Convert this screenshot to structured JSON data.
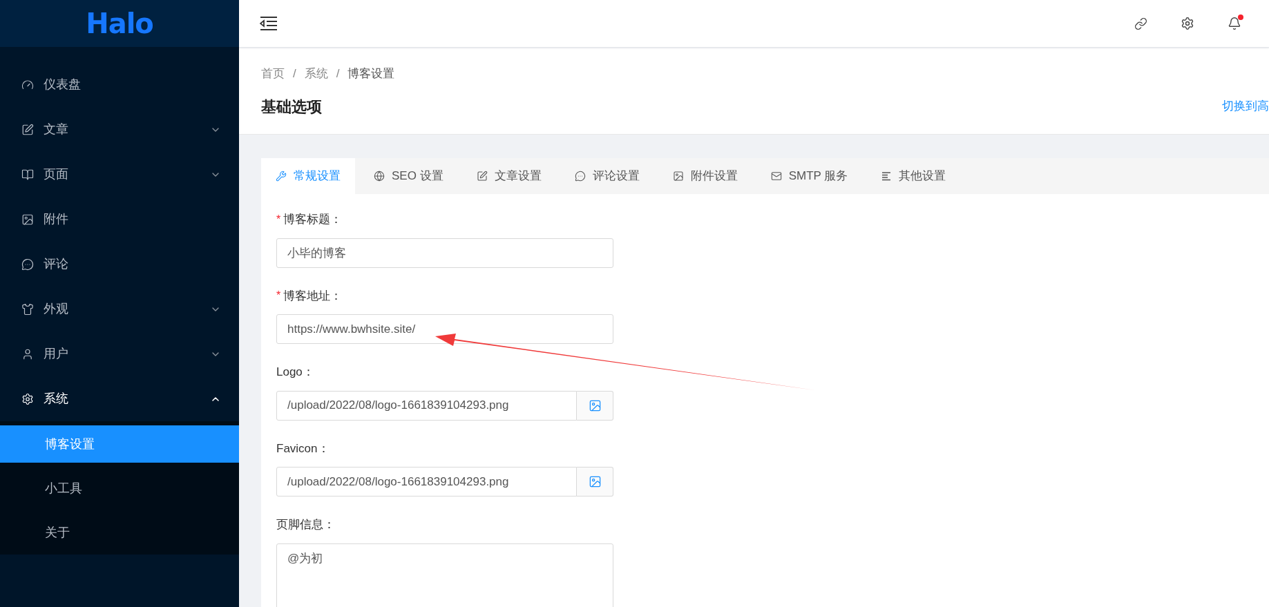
{
  "sidebar": {
    "logo": "Halo",
    "items": [
      {
        "label": "仪表盘",
        "expandable": false,
        "selected": false
      },
      {
        "label": "文章",
        "expandable": true,
        "expanded": false,
        "selected": false
      },
      {
        "label": "页面",
        "expandable": true,
        "expanded": false,
        "selected": false
      },
      {
        "label": "附件",
        "expandable": false,
        "selected": false
      },
      {
        "label": "评论",
        "expandable": false,
        "selected": false
      },
      {
        "label": "外观",
        "expandable": true,
        "expanded": false,
        "selected": false
      },
      {
        "label": "用户",
        "expandable": true,
        "expanded": false,
        "selected": false
      },
      {
        "label": "系统",
        "expandable": true,
        "expanded": true,
        "selected": true,
        "children": [
          {
            "label": "博客设置",
            "selected": true
          },
          {
            "label": "小工具",
            "selected": false
          },
          {
            "label": "关于",
            "selected": false
          }
        ]
      }
    ]
  },
  "header": {
    "notifications": {
      "unread": true
    }
  },
  "breadcrumb": {
    "separator": "/",
    "items": [
      "首页",
      "系统",
      "博客设置"
    ]
  },
  "page_title": "基础选项",
  "switch_link": "切换到高",
  "tabs": [
    {
      "label": "常规设置",
      "selected": true
    },
    {
      "label": "SEO 设置",
      "selected": false
    },
    {
      "label": "文章设置",
      "selected": false
    },
    {
      "label": "评论设置",
      "selected": false
    },
    {
      "label": "附件设置",
      "selected": false
    },
    {
      "label": "SMTP 服务",
      "selected": false
    },
    {
      "label": "其他设置",
      "selected": false
    }
  ],
  "form": {
    "required_mark": "*",
    "fields": [
      {
        "kind": "text",
        "label": "博客标题：",
        "required": true,
        "value": "小毕的博客"
      },
      {
        "kind": "text",
        "label": "博客地址：",
        "required": true,
        "value": "https://www.bwhsite.site/"
      },
      {
        "kind": "image",
        "label": "Logo：",
        "required": false,
        "value": "/upload/2022/08/logo-1661839104293.png"
      },
      {
        "kind": "image",
        "label": "Favicon：",
        "required": false,
        "value": "/upload/2022/08/logo-1661839104293.png"
      },
      {
        "kind": "textarea",
        "label": "页脚信息：",
        "required": false,
        "value": "@为初"
      }
    ]
  }
}
